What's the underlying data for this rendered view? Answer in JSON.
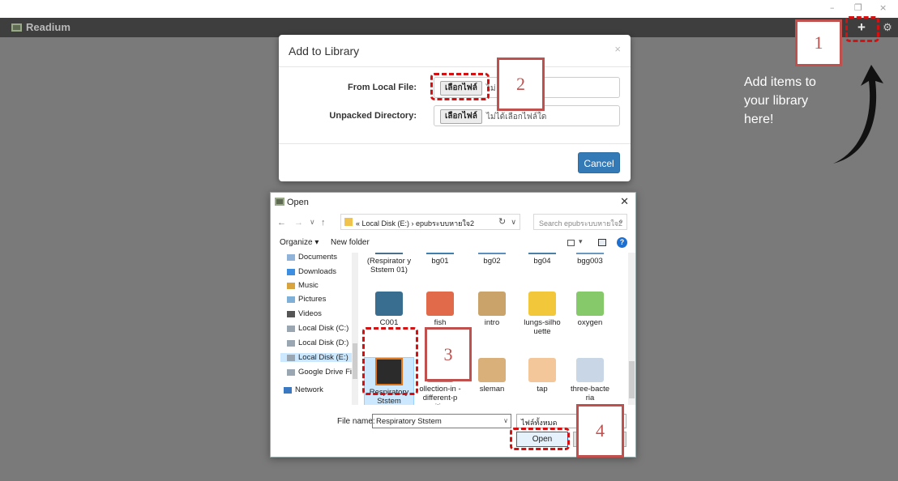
{
  "window": {
    "minimize": "–",
    "restore": "❐",
    "close": "×"
  },
  "app": {
    "name": "Readium",
    "add_label": "+",
    "settings_label": "⚙"
  },
  "modal": {
    "title": "Add to Library",
    "close": "×",
    "local_file_label": "From Local File:",
    "unpacked_label": "Unpacked Directory:",
    "choose_btn": "เลือกไฟล์",
    "local_file_status": "ไม่",
    "unpacked_status": "ไม่ได้เลือกไฟล์ใด",
    "cancel": "Cancel"
  },
  "hint": {
    "lines": [
      "Add items to",
      "your library",
      "here!"
    ]
  },
  "dialog": {
    "title": "Open",
    "close": "✕",
    "back": "←",
    "forward": "→",
    "recent": "∨",
    "up": "↑",
    "address": "« Local Disk (E:) › epubระบบหายใจ2",
    "address_drop": "∨",
    "refresh": "↻",
    "search_placeholder": "Search epubระบบหายใจ2",
    "search_icon": "⌕",
    "organize": "Organize ▾",
    "new_folder": "New folder",
    "view_drop": "▾",
    "help": "?",
    "nav_items": [
      {
        "label": "Documents",
        "icon": "documents-icon"
      },
      {
        "label": "Downloads",
        "icon": "downloads-icon"
      },
      {
        "label": "Music",
        "icon": "music-icon"
      },
      {
        "label": "Pictures",
        "icon": "pictures-icon"
      },
      {
        "label": "Videos",
        "icon": "videos-icon"
      },
      {
        "label": "Local Disk (C:)",
        "icon": "drive-icon"
      },
      {
        "label": "Local Disk (D:)",
        "icon": "drive-icon"
      },
      {
        "label": "Local Disk (E:)",
        "icon": "drive-icon",
        "selected": true
      },
      {
        "label": "Google Drive File",
        "icon": "drive-icon"
      },
      {
        "label": "Network",
        "icon": "network-icon"
      }
    ],
    "files": [
      {
        "name": "(Respirator y Ststem 01)",
        "row": 0,
        "col": 0
      },
      {
        "name": "bg01",
        "row": 0,
        "col": 1
      },
      {
        "name": "bg02",
        "row": 0,
        "col": 2
      },
      {
        "name": "bg04",
        "row": 0,
        "col": 3
      },
      {
        "name": "bgg003",
        "row": 0,
        "col": 4
      },
      {
        "name": "C001",
        "row": 1,
        "col": 0
      },
      {
        "name": "fish",
        "row": 1,
        "col": 1
      },
      {
        "name": "intro",
        "row": 1,
        "col": 2
      },
      {
        "name": "lungs-silho uette",
        "row": 1,
        "col": 3
      },
      {
        "name": "oxygen",
        "row": 1,
        "col": 4
      },
      {
        "name": "Respiratory Ststem",
        "row": 2,
        "col": 0,
        "selected": true
      },
      {
        "name": "ollection-in -different-p ositions",
        "row": 2,
        "col": 1
      },
      {
        "name": "sleman",
        "row": 2,
        "col": 2
      },
      {
        "name": "tap",
        "row": 2,
        "col": 3
      },
      {
        "name": "three-bacte ria",
        "row": 2,
        "col": 4
      }
    ],
    "file_name_label": "File name:",
    "file_name_value": "Respiratory Ststem",
    "file_name_drop": "∨",
    "file_type": "ไฟล์ทั้งหมด",
    "open": "Open"
  },
  "annotations": {
    "n1": "1",
    "n2": "2",
    "n3": "3",
    "n4": "4"
  },
  "colors": {
    "annotation_red": "#c0504d",
    "dash_red": "#d61010",
    "primary_blue": "#337ab7",
    "topbar": "#3e3e3e",
    "backdrop": "#7a7a7a"
  }
}
